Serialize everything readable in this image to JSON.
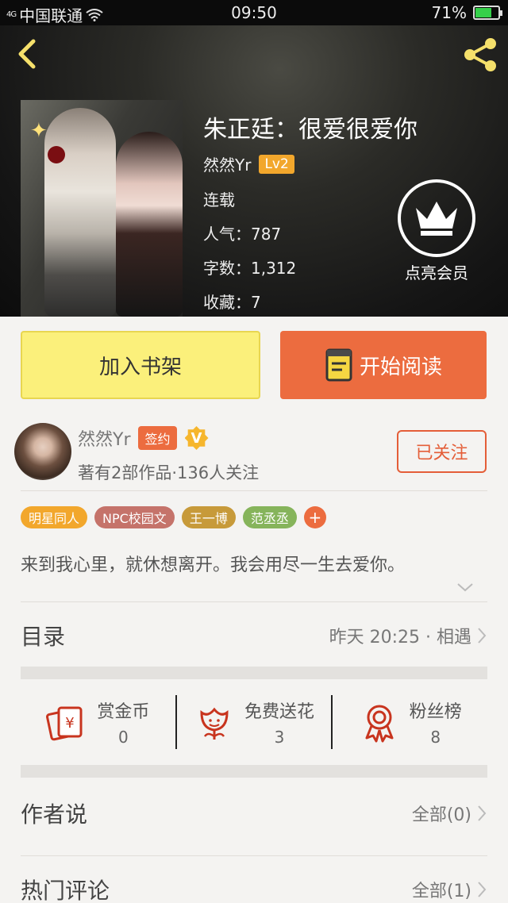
{
  "status_bar": {
    "signal": "4G",
    "carrier": "中国联通",
    "time": "09:50",
    "battery": "71%",
    "battery_level": 0.71
  },
  "book": {
    "title": "朱正廷：很爱很爱你",
    "author": "然然Yr",
    "level": "Lv2",
    "status": "连载",
    "popularity": "人气：787",
    "word_count": "字数：1,312",
    "favorites": "收藏：7",
    "vip_label": "点亮会员"
  },
  "actions": {
    "add_shelf": "加入书架",
    "start_reading": "开始阅读"
  },
  "author_block": {
    "name": "然然Yr",
    "signed_badge": "签约",
    "verified_badge": "V",
    "stats": "著有2部作品·136人关注",
    "follow_label": "已关注"
  },
  "tags": [
    {
      "label": "明星同人",
      "color": "#f2a72c"
    },
    {
      "label": "NPC校园文",
      "color": "#c5736a"
    },
    {
      "label": "王一博",
      "color": "#c79a3a"
    },
    {
      "label": "范丞丞",
      "color": "#86b45b"
    }
  ],
  "tag_add": "+",
  "intro": "来到我心里，就休想离开。我会用尽一生去爱你。",
  "catalog": {
    "title": "目录",
    "latest": "昨天 20:25 · 相遇"
  },
  "stats": [
    {
      "name": "赏金币",
      "value": "0",
      "icon": "coin-envelope-icon"
    },
    {
      "name": "免费送花",
      "value": "3",
      "icon": "flower-icon"
    },
    {
      "name": "粉丝榜",
      "value": "8",
      "icon": "medal-icon"
    }
  ],
  "author_says": {
    "title": "作者说",
    "count": "全部(0)"
  },
  "hot_comments": {
    "title": "热门评论",
    "count": "全部(1)"
  },
  "colors": {
    "accent_orange": "#ec6c3f",
    "shelf_yellow": "#fbf07b",
    "icon_red": "#c8341e",
    "back_yellow": "#f5e06b"
  }
}
